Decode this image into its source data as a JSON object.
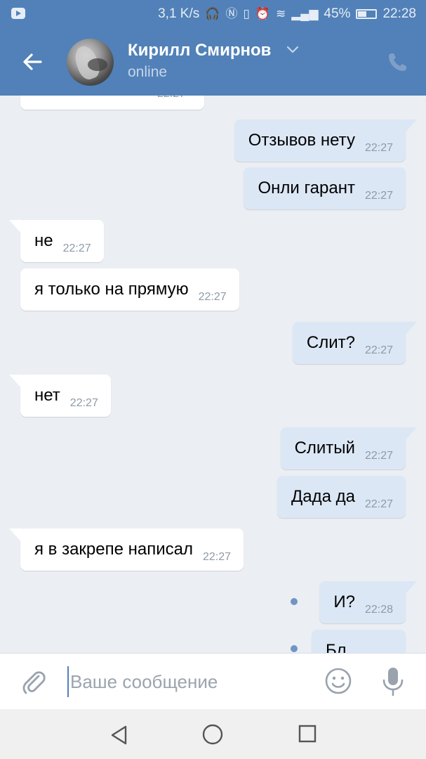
{
  "status_bar": {
    "speed": "3,1 K/s",
    "battery": "45%",
    "time": "22:28"
  },
  "header": {
    "name": "Кирилл Смирнов",
    "status": "online"
  },
  "messages": [
    {
      "dir": "in",
      "text": "",
      "time": "22:27"
    },
    {
      "dir": "out",
      "text": "Отзывов нету",
      "time": "22:27"
    },
    {
      "dir": "out",
      "text": "Онли гарант",
      "time": "22:27"
    },
    {
      "dir": "in",
      "text": "не",
      "time": "22:27"
    },
    {
      "dir": "in",
      "text": "я только на прямую",
      "time": "22:27"
    },
    {
      "dir": "out",
      "text": "Слит?",
      "time": "22:27"
    },
    {
      "dir": "in",
      "text": "нет",
      "time": "22:27"
    },
    {
      "dir": "out",
      "text": "Слитый",
      "time": "22:27"
    },
    {
      "dir": "out",
      "text": "Дада да",
      "time": "22:27"
    },
    {
      "dir": "in",
      "text": "я в закрепе написал",
      "time": "22:27"
    },
    {
      "dir": "out",
      "text": "И?",
      "time": "22:28"
    },
    {
      "dir": "out",
      "text": "Бл",
      "time": ""
    }
  ],
  "composer": {
    "placeholder": "Ваше сообщение"
  },
  "colors": {
    "accent": "#5181b8",
    "incoming_bubble": "#ffffff",
    "outgoing_bubble": "#dce7f5",
    "chat_background": "#ebeef3"
  }
}
